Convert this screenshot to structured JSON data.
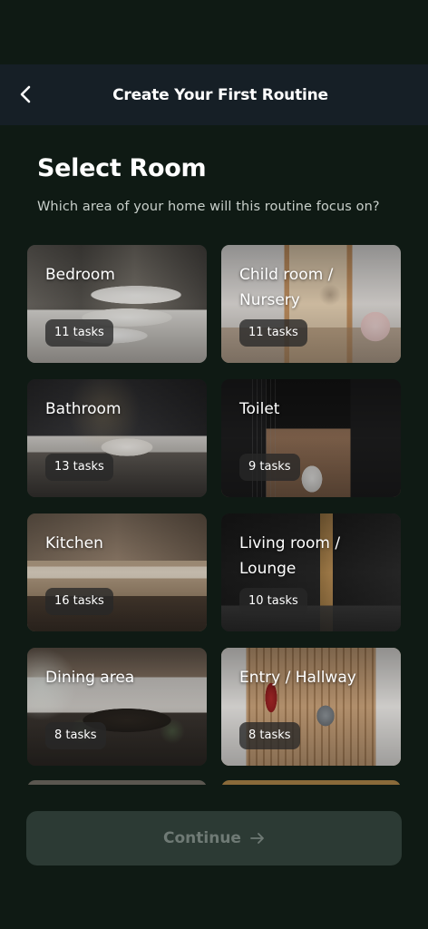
{
  "header": {
    "title": "Create Your First Routine",
    "back_icon": "chevron-left-icon"
  },
  "page": {
    "title": "Select Room",
    "subtitle": "Which area of your home will this routine focus on?"
  },
  "rooms": [
    {
      "name": "Bedroom",
      "tasks": "11 tasks"
    },
    {
      "name": "Child room / Nursery",
      "tasks": "11 tasks"
    },
    {
      "name": "Bathroom",
      "tasks": "13 tasks"
    },
    {
      "name": "Toilet",
      "tasks": "9 tasks"
    },
    {
      "name": "Kitchen",
      "tasks": "16 tasks"
    },
    {
      "name": "Living room / Lounge",
      "tasks": "10 tasks"
    },
    {
      "name": "Dining area",
      "tasks": "8 tasks"
    },
    {
      "name": "Entry / Hallway",
      "tasks": "8 tasks"
    }
  ],
  "footer": {
    "continue_label": "Continue",
    "continue_icon": "arrow-right-icon"
  },
  "colors": {
    "background": "#0f1a14",
    "header": "#161f26",
    "button_disabled": "#2c3a34",
    "button_text_disabled": "#6f7a75"
  }
}
